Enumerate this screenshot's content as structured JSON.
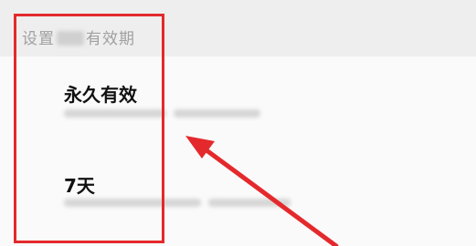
{
  "dialog": {
    "title_prefix": "设置",
    "title_suffix": "有效期"
  },
  "options": [
    {
      "label": "永久有效"
    },
    {
      "label": "7天"
    }
  ],
  "annotation": {
    "highlight_color": "#e4292c",
    "arrow_color": "#e4292c"
  }
}
